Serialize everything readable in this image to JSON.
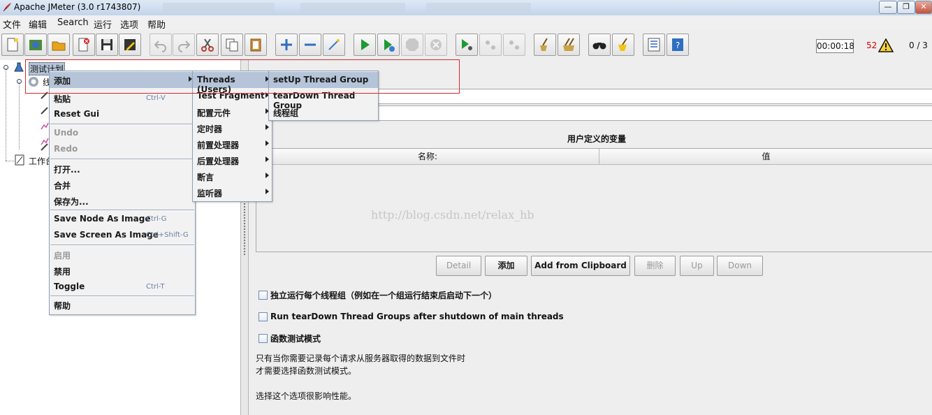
{
  "window": {
    "title": "Apache JMeter (3.0 r1743807)",
    "close_glyph": "✕",
    "restore_glyph": "❐",
    "minimize_glyph": "—"
  },
  "menubar": [
    "文件",
    "编辑",
    "Search",
    "运行",
    "选项",
    "帮助"
  ],
  "status": {
    "timer": "00:00:18",
    "error_count": "52",
    "threads": "0 / 3"
  },
  "tree": {
    "test_plan": "测试计划",
    "thread_group_partial": "线",
    "workbench_partial": "工作台"
  },
  "context_menu": {
    "items": [
      {
        "label": "添加",
        "accel": "",
        "has_sub": true,
        "selected": true,
        "enabled": true
      },
      {
        "label": "粘贴",
        "accel": "Ctrl-V",
        "has_sub": false,
        "selected": false,
        "enabled": true
      },
      {
        "label": "Reset Gui",
        "accel": "",
        "has_sub": false,
        "selected": false,
        "enabled": true
      },
      {
        "label": "Undo",
        "accel": "",
        "has_sub": false,
        "selected": false,
        "enabled": false
      },
      {
        "label": "Redo",
        "accel": "",
        "has_sub": false,
        "selected": false,
        "enabled": false
      },
      {
        "label": "打开...",
        "accel": "",
        "has_sub": false,
        "selected": false,
        "enabled": true
      },
      {
        "label": "合并",
        "accel": "",
        "has_sub": false,
        "selected": false,
        "enabled": true
      },
      {
        "label": "保存为...",
        "accel": "",
        "has_sub": false,
        "selected": false,
        "enabled": true
      },
      {
        "label": "Save Node As Image",
        "accel": "Ctrl-G",
        "has_sub": false,
        "selected": false,
        "enabled": true
      },
      {
        "label": "Save Screen As Image",
        "accel": "Ctrl+Shift-G",
        "has_sub": false,
        "selected": false,
        "enabled": true
      },
      {
        "label": "启用",
        "accel": "",
        "has_sub": false,
        "selected": false,
        "enabled": false
      },
      {
        "label": "禁用",
        "accel": "",
        "has_sub": false,
        "selected": false,
        "enabled": true
      },
      {
        "label": "Toggle",
        "accel": "Ctrl-T",
        "has_sub": false,
        "selected": false,
        "enabled": true
      },
      {
        "label": "帮助",
        "accel": "",
        "has_sub": false,
        "selected": false,
        "enabled": true
      }
    ]
  },
  "add_submenu": {
    "items": [
      {
        "label": "Threads (Users)",
        "selected": true
      },
      {
        "label": "Test Fragment",
        "selected": false
      },
      {
        "label": "配置元件",
        "selected": false
      },
      {
        "label": "定时器",
        "selected": false
      },
      {
        "label": "前置处理器",
        "selected": false
      },
      {
        "label": "后置处理器",
        "selected": false
      },
      {
        "label": "断言",
        "selected": false
      },
      {
        "label": "监听器",
        "selected": false
      }
    ]
  },
  "threads_submenu": {
    "items": [
      {
        "label": "setUp Thread Group",
        "selected": true
      },
      {
        "label": "tearDown Thread Group",
        "selected": false
      },
      {
        "label": "线程组",
        "selected": false
      }
    ]
  },
  "udv": {
    "title": "用户定义的变量",
    "col_name": "名称:",
    "col_value": "值"
  },
  "watermark": "http://blog.csdn.net/relax_hb",
  "buttons": {
    "detail": "Detail",
    "add": "添加",
    "add_clipboard": "Add from Clipboard",
    "delete": "删除",
    "up": "Up",
    "down": "Down"
  },
  "options": {
    "serialize": "独立运行每个线程组（例如在一个组运行结束后启动下一个）",
    "teardown": "Run tearDown Thread Groups after shutdown of main threads",
    "functional": "函数测试模式"
  },
  "notes": {
    "line1": "只有当你需要记录每个请求从服务器取得的数据到文件时",
    "line2": "才需要选择函数测试模式。",
    "line3": "选择这个选项很影响性能。"
  }
}
